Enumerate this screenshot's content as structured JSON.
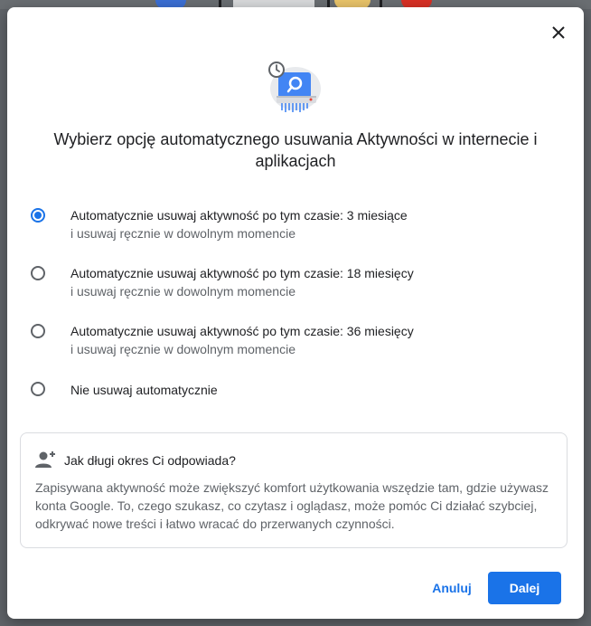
{
  "dialog": {
    "title": "Wybierz opcję automatycznego usuwania Aktywności w internecie i aplikacjach",
    "options": [
      {
        "main": "Automatycznie usuwaj aktywność po tym czasie: 3 miesiące",
        "sub": "i usuwaj ręcznie w dowolnym momencie",
        "selected": true
      },
      {
        "main": "Automatycznie usuwaj aktywność po tym czasie: 18 miesięcy",
        "sub": "i usuwaj ręcznie w dowolnym momencie",
        "selected": false
      },
      {
        "main": "Automatycznie usuwaj aktywność po tym czasie: 36 miesięcy",
        "sub": "i usuwaj ręcznie w dowolnym momencie",
        "selected": false
      },
      {
        "main": "Nie usuwaj automatycznie",
        "sub": "",
        "selected": false
      }
    ],
    "info": {
      "title": "Jak długi okres Ci odpowiada?",
      "body": "Zapisywana aktywność może zwiększyć komfort użytkowania wszędzie tam, gdzie używasz konta Google. To, czego szukasz, co czytasz i oglądasz, może pomóc Ci działać szybciej, odkrywać nowe treści i łatwo wracać do przerwanych czynności."
    },
    "buttons": {
      "cancel": "Anuluj",
      "next": "Dalej"
    }
  },
  "icons": {
    "close": "close-icon",
    "hero": "auto-delete-illustration",
    "info": "person-add-icon"
  },
  "colors": {
    "accent": "#1a73e8",
    "text": "#202124",
    "secondary_text": "#5f6368",
    "border": "#dadce0"
  }
}
